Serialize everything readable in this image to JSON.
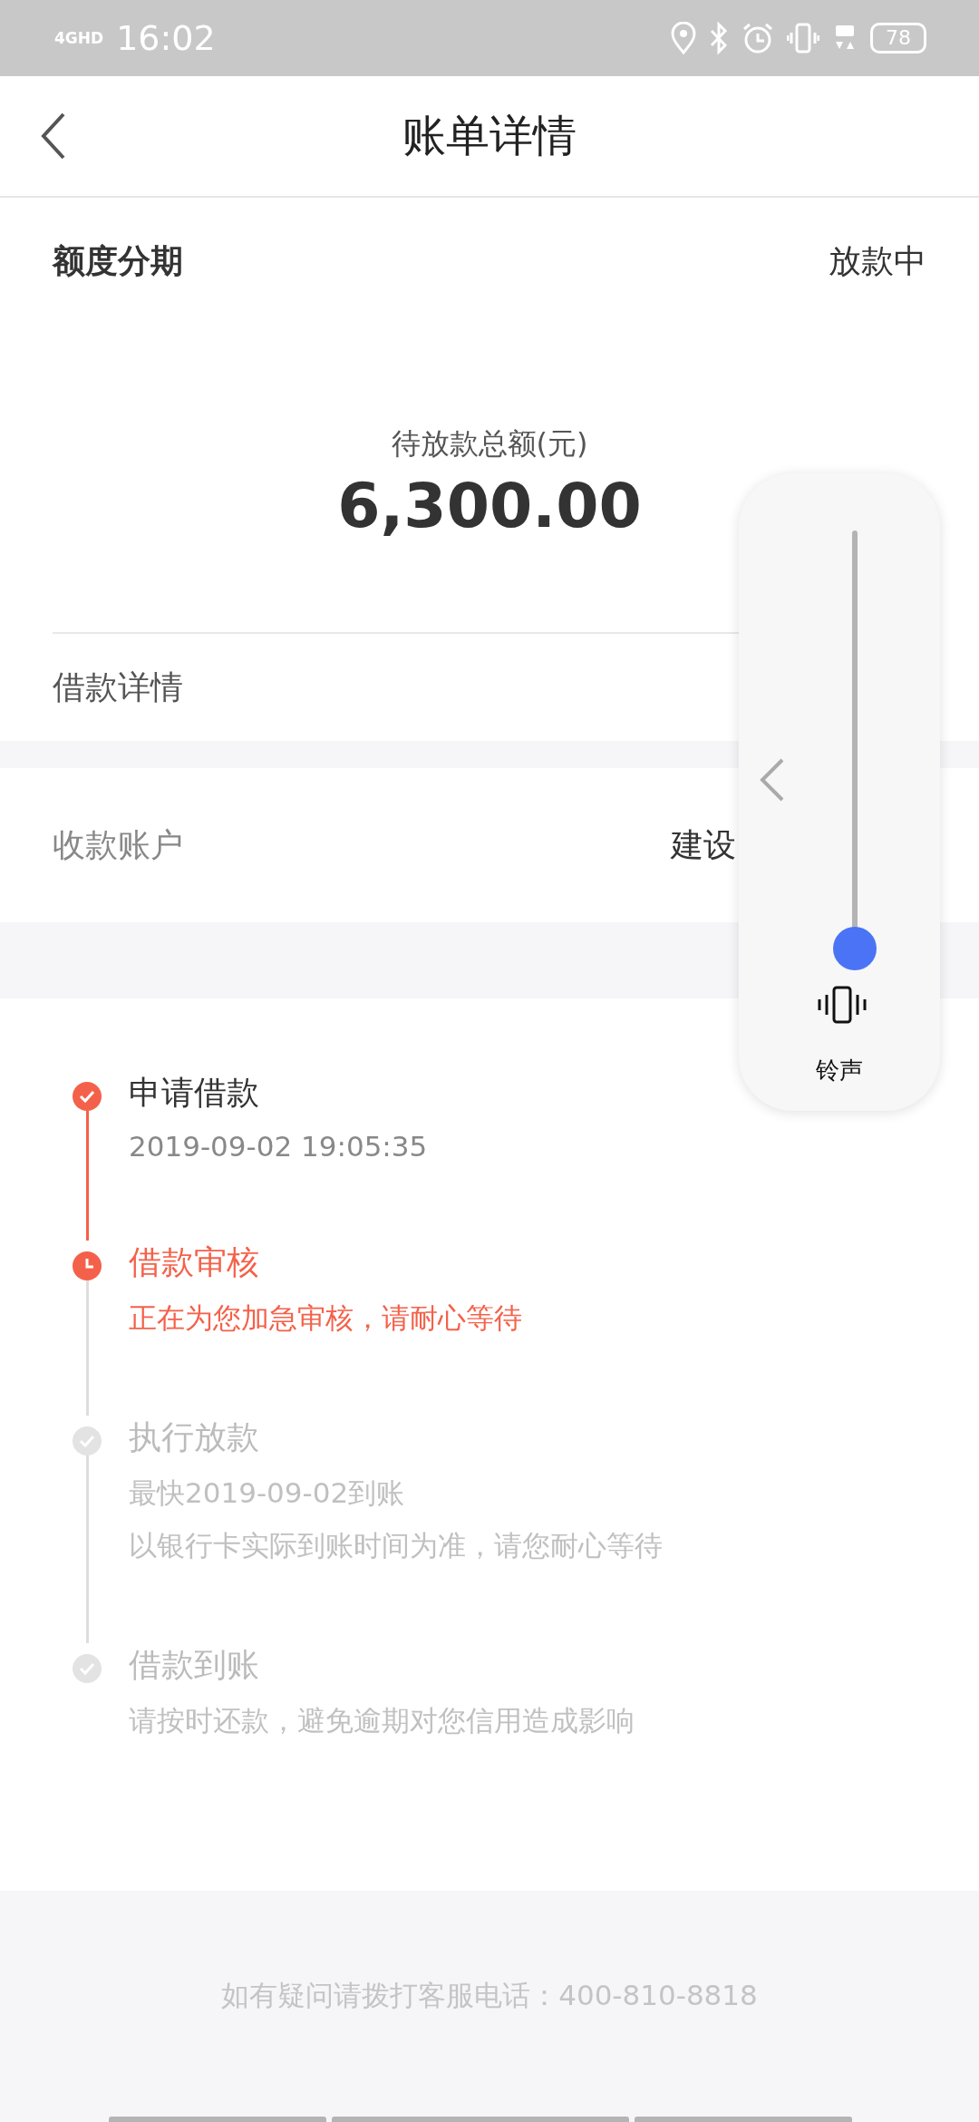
{
  "status_bar": {
    "network": "4GHD",
    "time": "16:02",
    "battery": "78"
  },
  "header": {
    "title": "账单详情"
  },
  "summary": {
    "product": "额度分期",
    "status": "放款中",
    "amount_label": "待放款总额(元)",
    "amount": "6,300.00",
    "details_link": "借款详情"
  },
  "account": {
    "label": "收款账户",
    "value": "建设"
  },
  "timeline": [
    {
      "title": "申请借款",
      "done": true,
      "current": false,
      "lines": [
        "2019-09-02 19:05:35"
      ]
    },
    {
      "title": "借款审核",
      "done": false,
      "current": true,
      "lines": [
        "正在为您加急审核，请耐心等待"
      ]
    },
    {
      "title": "执行放款",
      "done": false,
      "current": false,
      "lines": [
        "最快2019-09-02到账",
        "以银行卡实际到账时间为准，请您耐心等待"
      ]
    },
    {
      "title": "借款到账",
      "done": false,
      "current": false,
      "lines": [
        "请按时还款，避免逾期对您信用造成影响"
      ]
    }
  ],
  "footer": {
    "hotline": "如有疑问请拨打客服电话：400-810-8818"
  },
  "volume_panel": {
    "level": 0,
    "mode": "铃声"
  }
}
